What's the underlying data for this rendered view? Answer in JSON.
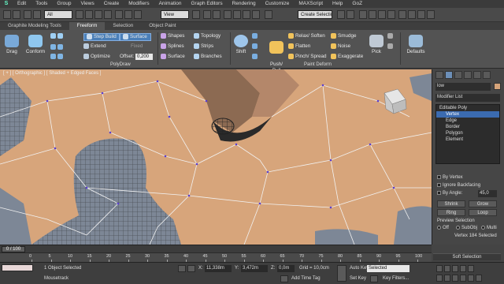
{
  "menubar": {
    "logo": "S",
    "items": [
      "Edit",
      "Tools",
      "Group",
      "Views",
      "Create",
      "Modifiers",
      "Animation",
      "Graph Editors",
      "Rendering",
      "Customize",
      "MAXScript",
      "Help",
      "GoZ"
    ]
  },
  "toolbar": {
    "filter_value": "All",
    "refcoord_value": "View",
    "selection_set_value": "Create Selection S"
  },
  "ribbon_tabs": {
    "items": [
      {
        "label": "Graphite Modeling Tools"
      },
      {
        "label": "Freeform"
      },
      {
        "label": "Selection"
      },
      {
        "label": "Object Paint"
      }
    ],
    "active_index": 1
  },
  "ribbon": {
    "drag_label": "Drag",
    "conform_label": "Conform",
    "step_build_label": "Step Build",
    "extend_label": "Extend",
    "optimize_label": "Optimize",
    "surface_value": "Surface",
    "fixed_label": "Fixed",
    "offset_label": "Offset:",
    "offset_value": "0,200",
    "shapes_label": "Shapes",
    "splines_label": "Splines",
    "surface_label": "Surface",
    "topology_label": "Topology",
    "strips_label": "Strips",
    "branches_label": "Branches",
    "shift_label": "Shift",
    "push_pull_label": "Push/\nPull",
    "relax_soften_label": "Relax/ Soften",
    "flatten_label": "Flatten",
    "pinch_spread_label": "Pinch/ Spread",
    "smudge_label": "Smudge",
    "noise_label": "Noise",
    "exaggerate_label": "Exaggerate",
    "pick_label": "Pick",
    "defaults_label": "Defaults",
    "polydraw_panel": "PolyDraw",
    "paint_deform_panel": "Paint Deform"
  },
  "viewport": {
    "label": "[ + ] [ Orthographic ] [ Shaded + Edged Faces ]"
  },
  "command_panel": {
    "object_name": "low",
    "modifier_list": "Modifier List",
    "stack_items": [
      {
        "label": "Editable Poly",
        "level": 0,
        "selected": false
      },
      {
        "label": "Vertex",
        "level": 1,
        "selected": true
      },
      {
        "label": "Edge",
        "level": 1,
        "selected": false
      },
      {
        "label": "Border",
        "level": 1,
        "selected": false
      },
      {
        "label": "Polygon",
        "level": 1,
        "selected": false
      },
      {
        "label": "Element",
        "level": 1,
        "selected": false
      }
    ],
    "by_vertex": "By Vertex",
    "ignore_backfacing": "Ignore Backfacing",
    "by_angle": "By Angle:",
    "by_angle_value": "45,0",
    "shrink": "Shrink",
    "grow": "Grow",
    "ring": "Ring",
    "loop": "Loop",
    "preview_selection": "Preview Selection",
    "off": "Off",
    "subobj": "SubObj",
    "multi": "Multi",
    "selected_info": "Vertex 184 Selected",
    "soft_selection": "Soft Selection"
  },
  "timeline": {
    "slider_label": "0 / 100",
    "ticks": [
      0,
      5,
      10,
      15,
      20,
      25,
      30,
      35,
      40,
      45,
      50,
      55,
      60,
      65,
      70,
      75,
      80,
      85,
      90,
      95,
      100
    ]
  },
  "status": {
    "objects_selected": "1 Object Selected",
    "prompt_mode": "Mousetrack",
    "x_label": "X:",
    "x_value": "11,338m",
    "y_label": "Y:",
    "y_value": "3,472m",
    "z_label": "Z:",
    "z_value": "0,0m",
    "grid": "Grid = 10,0cm",
    "add_time_tag": "Add Time Tag",
    "auto_key": "Auto Key",
    "auto_key_value": "Selected",
    "set_key": "Set Key",
    "key_filters": "Key Filters..."
  },
  "colors": {
    "skin": "#d6a47a",
    "shadow": "#7b8797",
    "wire": "#f4f4f4",
    "highlight": "#3b6bb0"
  }
}
